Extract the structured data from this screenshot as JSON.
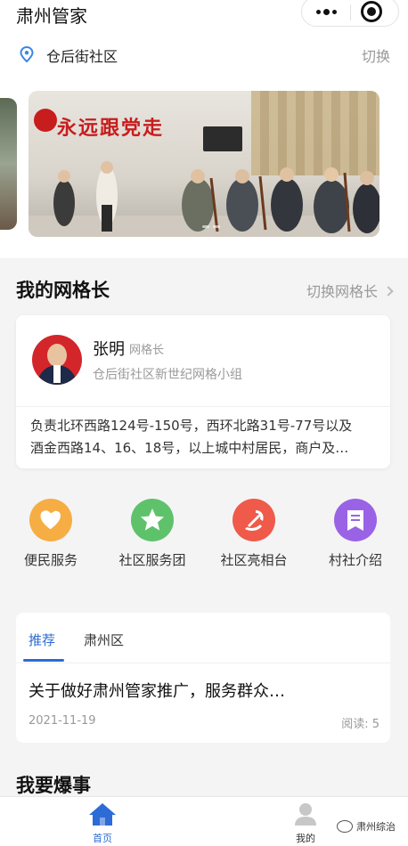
{
  "header": {
    "title": "肃州管家"
  },
  "location": {
    "name": "仓后街社区",
    "switch_label": "切换"
  },
  "banner": {
    "wall_text": "永远跟党走"
  },
  "grid_leader_section": {
    "title": "我的网格长",
    "switch_label": "切换网格长"
  },
  "grid_leader": {
    "name": "张明",
    "role": "网格长",
    "group": "仓后街社区新世纪网格小组",
    "description_line1": "负责北环西路124号-150号，西环北路31号-77号以及",
    "description_line2": "酒金西路14、16、18号，以上城中村居民，商户及…"
  },
  "services": [
    {
      "label": "便民服务",
      "color": "#f6ad44",
      "icon": "heart-icon"
    },
    {
      "label": "社区服务团",
      "color": "#5ec26a",
      "icon": "star-icon"
    },
    {
      "label": "社区亮相台",
      "color": "#ef5a4b",
      "icon": "party-emblem-icon"
    },
    {
      "label": "村社介绍",
      "color": "#9a63e6",
      "icon": "document-icon"
    }
  ],
  "news": {
    "tabs": [
      {
        "label": "推荐"
      },
      {
        "label": "肃州区"
      }
    ],
    "item": {
      "title": "关于做好肃州管家推广，服务群众…",
      "date": "2021-11-19",
      "reads": "阅读: 5"
    }
  },
  "report": {
    "title": "我要爆事"
  },
  "tabbar": {
    "home_label": "首页",
    "mine_label": "我的"
  },
  "watermark": {
    "text": "肃州综治"
  },
  "colors": {
    "accent": "#2d6bd6",
    "party_red": "#c81d1d"
  }
}
